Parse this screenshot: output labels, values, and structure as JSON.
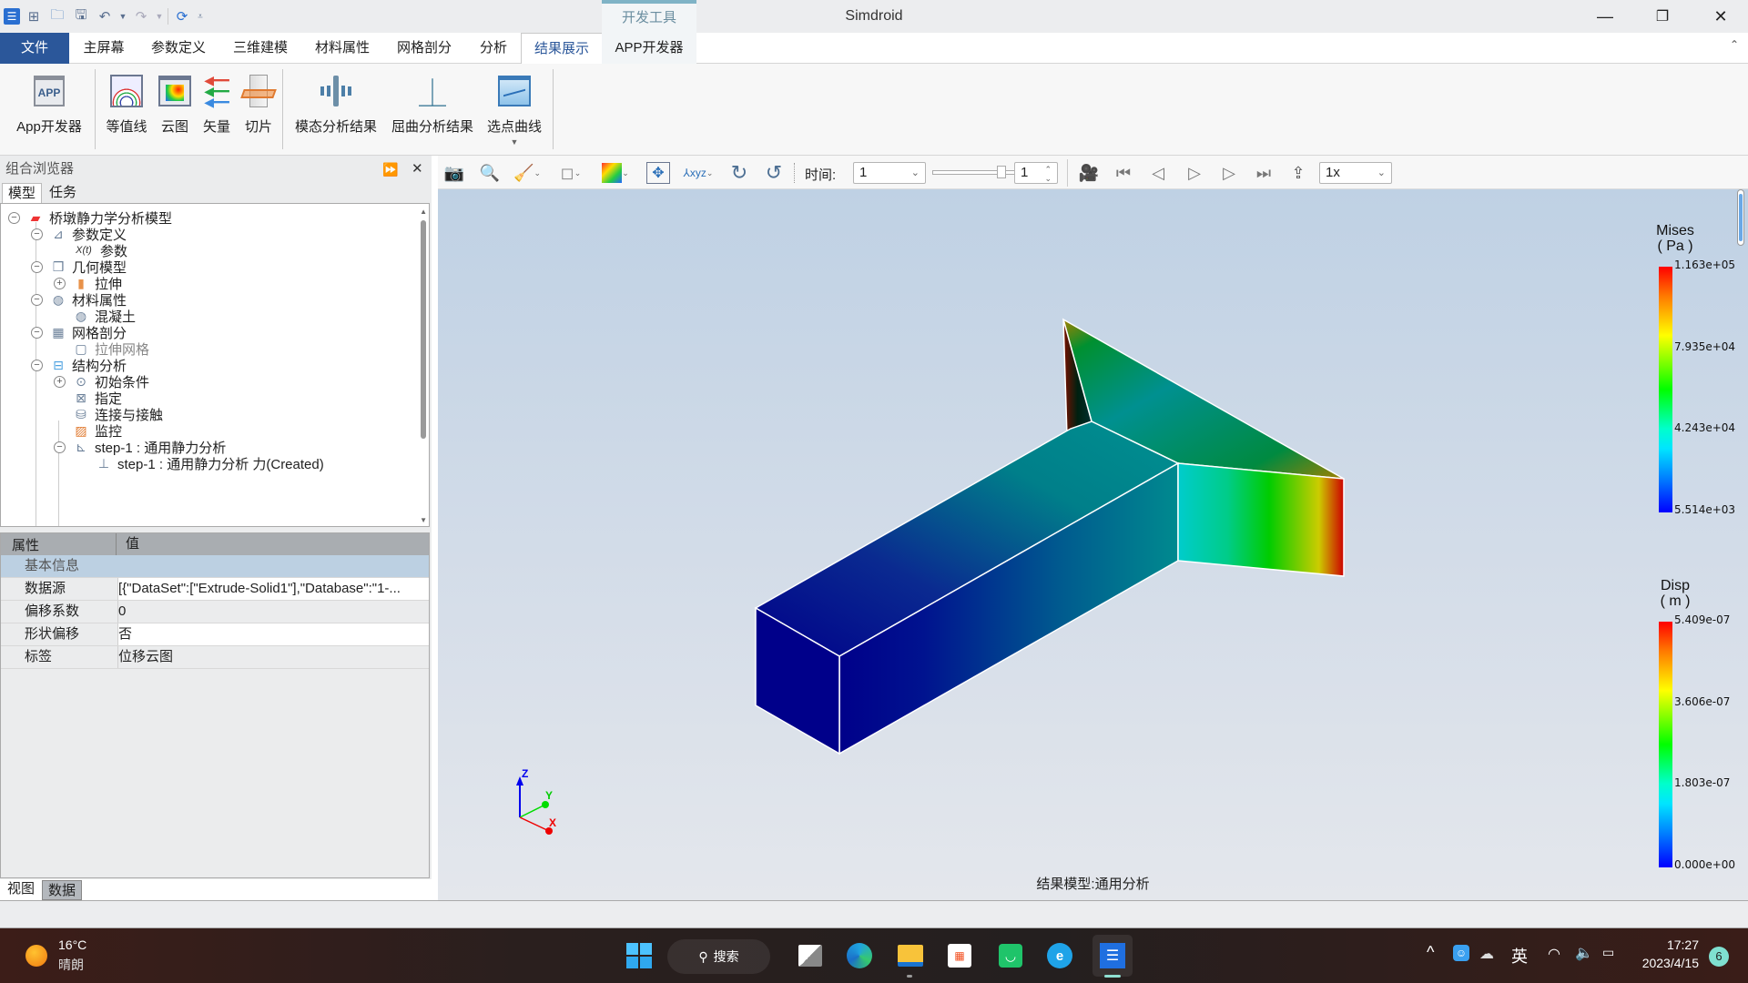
{
  "window": {
    "title": "Simdroid",
    "context_tab": "开发工具",
    "controls": {
      "minimize": "—",
      "restore": "❐",
      "close": "✕"
    }
  },
  "quick_access": [
    "app-logo",
    "new",
    "open",
    "save",
    "undo",
    "redo",
    "refresh",
    "customize"
  ],
  "ribbon_tabs": [
    {
      "label": "文件",
      "kind": "file"
    },
    {
      "label": "主屏幕"
    },
    {
      "label": "参数定义"
    },
    {
      "label": "三维建模"
    },
    {
      "label": "材料属性"
    },
    {
      "label": "网格剖分"
    },
    {
      "label": "分析"
    },
    {
      "label": "结果展示",
      "active": true
    },
    {
      "label": "APP开发器",
      "kind": "context"
    }
  ],
  "ribbon_buttons": [
    {
      "label": "App开发器",
      "icon": "app-developer-icon"
    },
    {
      "label": "等值线",
      "icon": "contour-lines-icon"
    },
    {
      "label": "云图",
      "icon": "cloud-map-icon"
    },
    {
      "label": "矢量",
      "icon": "vector-icon"
    },
    {
      "label": "切片",
      "icon": "slice-icon"
    },
    {
      "label": "模态分析结果",
      "icon": "modal-analysis-icon"
    },
    {
      "label": "屈曲分析结果",
      "icon": "buckling-analysis-icon"
    },
    {
      "label": "选点曲线",
      "icon": "point-curve-icon"
    }
  ],
  "left_panel": {
    "title": "组合浏览器",
    "tabs": [
      "模型",
      "任务"
    ],
    "tree": [
      {
        "label": "桥墩静力学分析模型",
        "level": 0,
        "toggle": "−",
        "icon": "result-model-icon"
      },
      {
        "label": "参数定义",
        "level": 1,
        "toggle": "−",
        "icon": "parameter-definition-icon"
      },
      {
        "label": "参数",
        "level": 2,
        "toggle": "",
        "icon": "variable-icon",
        "icon_text": "X(t)"
      },
      {
        "label": "几何模型",
        "level": 1,
        "toggle": "−",
        "icon": "geometry-model-icon"
      },
      {
        "label": "拉伸",
        "level": 2,
        "toggle": "+",
        "icon": "extrude-icon"
      },
      {
        "label": "材料属性",
        "level": 1,
        "toggle": "−",
        "icon": "material-icon"
      },
      {
        "label": "混凝土",
        "level": 2,
        "toggle": "",
        "icon": "concrete-icon"
      },
      {
        "label": "网格剖分",
        "level": 1,
        "toggle": "−",
        "icon": "mesh-icon"
      },
      {
        "label": "拉伸网格",
        "level": 2,
        "toggle": "",
        "icon": "extrude-mesh-icon",
        "dim": true
      },
      {
        "label": "结构分析",
        "level": 1,
        "toggle": "−",
        "icon": "structural-analysis-icon"
      },
      {
        "label": "初始条件",
        "level": 2,
        "toggle": "+",
        "icon": "initial-condition-icon"
      },
      {
        "label": "指定",
        "level": 2,
        "toggle": "",
        "icon": "assign-icon"
      },
      {
        "label": "连接与接触",
        "level": 2,
        "toggle": "",
        "icon": "contact-icon"
      },
      {
        "label": "监控",
        "level": 2,
        "toggle": "",
        "icon": "monitor-icon"
      },
      {
        "label": "step-1 : 通用静力分析",
        "level": 2,
        "toggle": "−",
        "icon": "step-icon"
      },
      {
        "label": "step-1 : 通用静力分析 力(Created)",
        "level": 3,
        "toggle": "",
        "icon": "force-icon"
      }
    ],
    "properties": {
      "header": [
        "属性",
        "值"
      ],
      "group": "基本信息",
      "rows": [
        {
          "name": "数据源",
          "value": "[{\"DataSet\":[\"Extrude-Solid1\"],\"Database\":\"1-..."
        },
        {
          "name": "偏移系数",
          "value": "0"
        },
        {
          "name": "形状偏移",
          "value": "否"
        },
        {
          "name": "标签",
          "value": "位移云图"
        }
      ]
    },
    "bottom_tabs": [
      "视图",
      "数据"
    ]
  },
  "view_toolbar": {
    "time_label": "时间:",
    "time_value": "1",
    "frame_value": "1",
    "speed_value": "1x"
  },
  "viewport": {
    "caption": "结果模型:通用分析",
    "axes": {
      "x": "X",
      "y": "Y",
      "z": "Z"
    },
    "legends": [
      {
        "title": "Mises",
        "unit": "( Pa )",
        "labels": [
          "1.163e+05",
          "7.935e+04",
          "4.243e+04",
          "5.514e+03"
        ]
      },
      {
        "title": "Disp",
        "unit": "( m )",
        "labels": [
          "5.409e-07",
          "3.606e-07",
          "1.803e-07",
          "0.000e+00"
        ]
      }
    ]
  },
  "taskbar": {
    "weather_temp": "16°C",
    "weather_desc": "晴朗",
    "search_label": "搜索",
    "ime": "英",
    "time": "17:27",
    "date": "2023/4/15",
    "notification_count": "6"
  }
}
